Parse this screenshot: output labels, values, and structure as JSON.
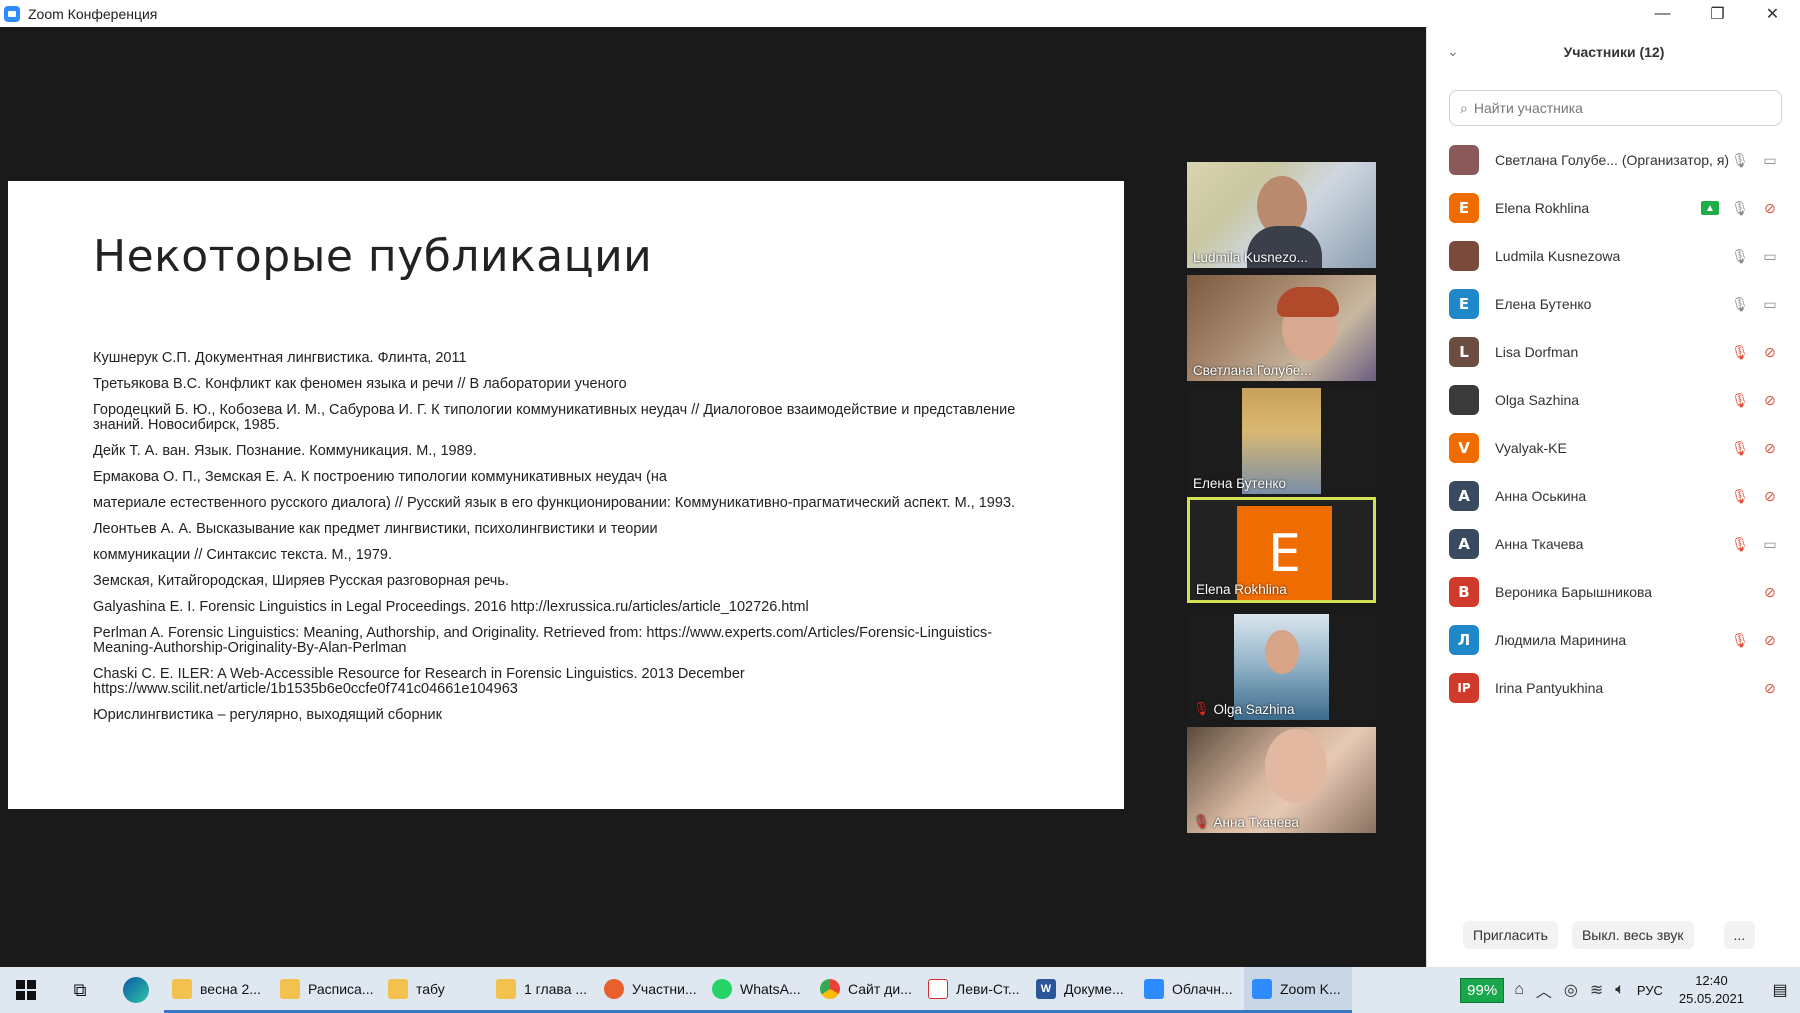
{
  "window": {
    "title": "Zoom Конференция",
    "min": "—",
    "max": "❐",
    "close": "✕"
  },
  "slide": {
    "title": "Некоторые публикации",
    "refs": [
      "Кушнерук С.П. Документная лингвистика. Флинта, 2011",
      "Третьякова В.С. Конфликт как феномен языка и речи // В лаборатории ученого",
      "Городецкий Б. Ю., Кобозева И. М., Сабурова И. Г. К типологии коммуникативных неудач // Диалоговое взаимодействие и представление знаний. Новосибирск, 1985.",
      "Дейк Т. А. ван. Язык. Познание. Коммуникация. М., 1989.",
      "Ермакова О. П., Земская Е. А. К построению типологии коммуникативных неудач (на",
      "материале естественного русского диалога) // Русский язык в его функционировании: Коммуникативно-прагматический аспект. М., 1993.",
      "Леонтьев А. А. Высказывание как предмет лингвистики, психолингвистики и теории",
      "коммуникации // Синтаксис текста. М., 1979.",
      "Земская, Китайгородская, Ширяев Русская разговорная речь.",
      "Galyashina E. I. Forensic Linguistics in Legal Proceedings. 2016 http://lexrussica.ru/articles/article_102726.html",
      "Perlman A. Forensic Linguistics: Meaning, Authorship, and Originality. Retrieved from: https://www.experts.com/Articles/Forensic-Linguistics-Meaning-Authorship-Originality-By-Alan-Perlman",
      "Chaski C. E. ILER: A Web-Accessible Resource for Research in Forensic Linguistics. 2013 December https://www.scilit.net/article/1b1535b6e0ccfe0f741c04661e104963",
      "Юрислингвистика – регулярно, выходящий сборник"
    ]
  },
  "tiles": [
    {
      "name": "Ludmila Kusnezo..."
    },
    {
      "name": "Светлана Голубе..."
    },
    {
      "name": "Елена Бутенко"
    },
    {
      "name": "Elena Rokhlina",
      "avatar": "E"
    },
    {
      "name": "Olga Sazhina"
    },
    {
      "name": "Анна Ткачева"
    }
  ],
  "panel": {
    "title": "Участники (12)",
    "search_placeholder": "Найти участника",
    "participants": [
      {
        "name": "Светлана Голубе... (Организатор, я)",
        "initial": "",
        "color": "#8a5a5a"
      },
      {
        "name": "Elena Rokhlina",
        "initial": "E",
        "color": "#ef6c00"
      },
      {
        "name": "Ludmila Kusnezowa",
        "initial": "",
        "color": "#7a4a3a"
      },
      {
        "name": "Елена Бутенко",
        "initial": "E",
        "color": "#1e88c8"
      },
      {
        "name": "Lisa Dorfman",
        "initial": "L",
        "color": "#6d4c41"
      },
      {
        "name": "Olga Sazhina",
        "initial": "",
        "color": "#3a3a3a"
      },
      {
        "name": "Vyalyak-KE",
        "initial": "V",
        "color": "#ef6c00"
      },
      {
        "name": "Анна Оськина",
        "initial": "А",
        "color": "#3a4a60"
      },
      {
        "name": "Анна Ткачева",
        "initial": "А",
        "color": "#3a4a60"
      },
      {
        "name": "Вероника Барышникова",
        "initial": "В",
        "color": "#d03a2a"
      },
      {
        "name": "Людмила Маринина",
        "initial": "Л",
        "color": "#1e88c8"
      },
      {
        "name": "Irina Pantyukhina",
        "initial": "IP",
        "color": "#d03a2a"
      }
    ],
    "invite": "Пригласить",
    "mute_all": "Выкл. весь звук",
    "more": "..."
  },
  "taskbar": {
    "apps": [
      {
        "label": "весна 2...",
        "icon": "",
        "color": "#f2c14e"
      },
      {
        "label": "Расписа...",
        "icon": "",
        "color": "#f2c14e"
      },
      {
        "label": "табу",
        "icon": "",
        "color": "#f2c14e"
      },
      {
        "label": "1 глава ...",
        "icon": "",
        "color": "#f2c14e"
      },
      {
        "label": "Участни...",
        "icon": "",
        "color": "#e8602c"
      },
      {
        "label": "WhatsA...",
        "icon": "",
        "color": "#25d366"
      },
      {
        "label": "Сайт ди...",
        "icon": "",
        "color": "#4285f4"
      },
      {
        "label": "Леви-Ст...",
        "icon": "",
        "color": "#d32f2f"
      },
      {
        "label": "Докуме...",
        "icon": "W",
        "color": "#2b579a"
      },
      {
        "label": "Облачн...",
        "icon": "",
        "color": "#2d8cff"
      },
      {
        "label": "Zoom K...",
        "icon": "",
        "color": "#2d8cff"
      }
    ],
    "battery": "99%",
    "lang": "РУС",
    "time": "12:40",
    "date": "25.05.2021"
  }
}
